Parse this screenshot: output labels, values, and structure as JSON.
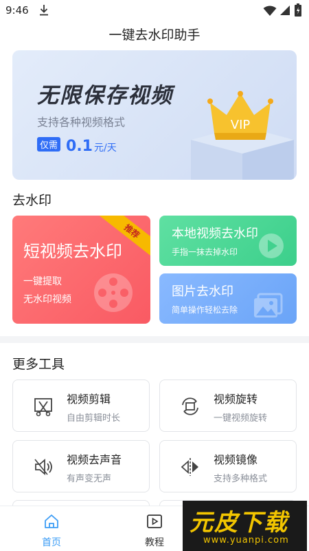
{
  "status_bar": {
    "time": "9:46"
  },
  "app_title": "一键去水印助手",
  "banner": {
    "title": "无限保存视频",
    "subtitle": "支持各种视频格式",
    "price_tag": "仅需",
    "price_value": "0.1",
    "price_unit": "元/天",
    "badge": "VIP"
  },
  "watermark_section": {
    "title": "去水印",
    "short_video": {
      "title": "短视频去水印",
      "line1": "一键提取",
      "line2": "无水印视频",
      "ribbon": "推荐"
    },
    "local_video": {
      "title": "本地视频去水印",
      "subtitle": "手指一抹去掉水印"
    },
    "image": {
      "title": "图片去水印",
      "subtitle": "简单操作轻松去除"
    }
  },
  "tools_section": {
    "title": "更多工具",
    "items": [
      {
        "name": "视频剪辑",
        "desc": "自由剪辑时长"
      },
      {
        "name": "视频旋转",
        "desc": "一键视频旋转"
      },
      {
        "name": "视频去声音",
        "desc": "有声变无声"
      },
      {
        "name": "视频镜像",
        "desc": "支持多种格式"
      }
    ]
  },
  "bottom_nav": {
    "home": "首页",
    "tutorial": "教程"
  },
  "overlay_watermark": {
    "main": "元皮下载",
    "url": "www.yuanpi.com"
  },
  "colors": {
    "accent": "#3b9cf5",
    "red_card": "#f95a63",
    "green_card": "#3ccf8b",
    "blue_card": "#6aa4f7"
  }
}
